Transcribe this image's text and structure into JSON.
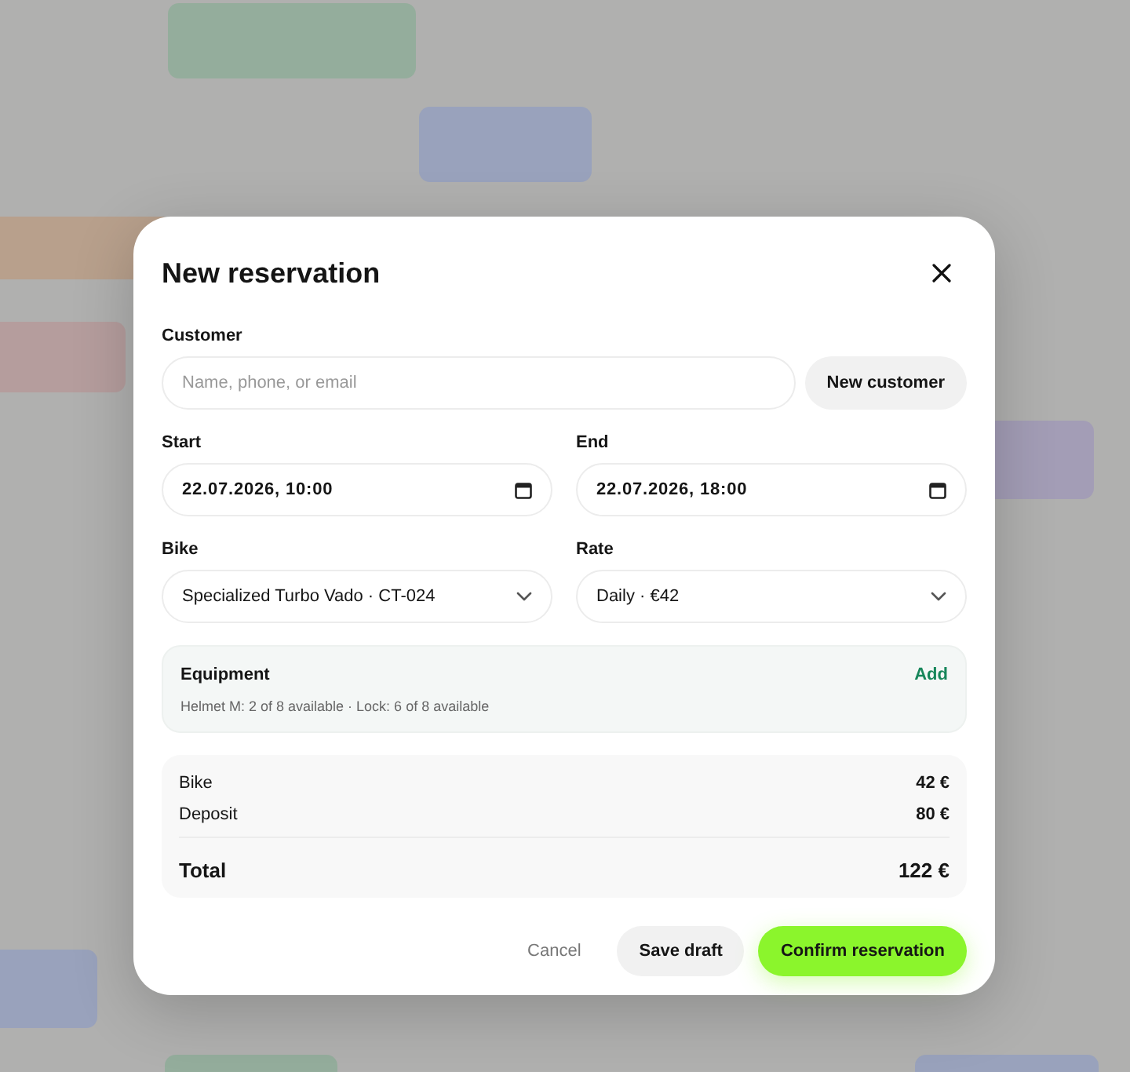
{
  "background_events": [
    {
      "color": "#94ad9c"
    },
    {
      "color": "#99a2bc"
    },
    {
      "color": "#b8a08c"
    },
    {
      "color": "#b59d9d"
    },
    {
      "color": "#a39db6"
    },
    {
      "color": "#99a2bc"
    },
    {
      "color": "#94ad9c"
    },
    {
      "color": "#99a2bc"
    }
  ],
  "dialog": {
    "title": "New reservation",
    "customer": {
      "label": "Customer",
      "placeholder": "Name, phone, or email",
      "button": "New customer"
    },
    "start": {
      "label": "Start",
      "value": "22.07.2026, 10:00"
    },
    "end": {
      "label": "End",
      "value": "22.07.2026, 18:00"
    },
    "bike": {
      "label": "Bike",
      "value": "Specialized Turbo Vado · CT-024"
    },
    "rate": {
      "label": "Rate",
      "value": "Daily · €42"
    },
    "equipment": {
      "title": "Equipment",
      "action": "Add",
      "availability": "Helmet M: 2 of 8 available · Lock: 6 of 8 available"
    },
    "summary": {
      "lines": [
        {
          "label": "Bike",
          "amount": "42 €"
        },
        {
          "label": "Deposit",
          "amount": "80 €"
        }
      ],
      "total": {
        "label": "Total",
        "amount": "122 €"
      }
    },
    "buttons": [
      {
        "label": "Cancel",
        "kind": "text"
      },
      {
        "label": "Save draft",
        "kind": "secondary"
      },
      {
        "label": "Confirm reservation",
        "kind": "primary"
      }
    ]
  }
}
